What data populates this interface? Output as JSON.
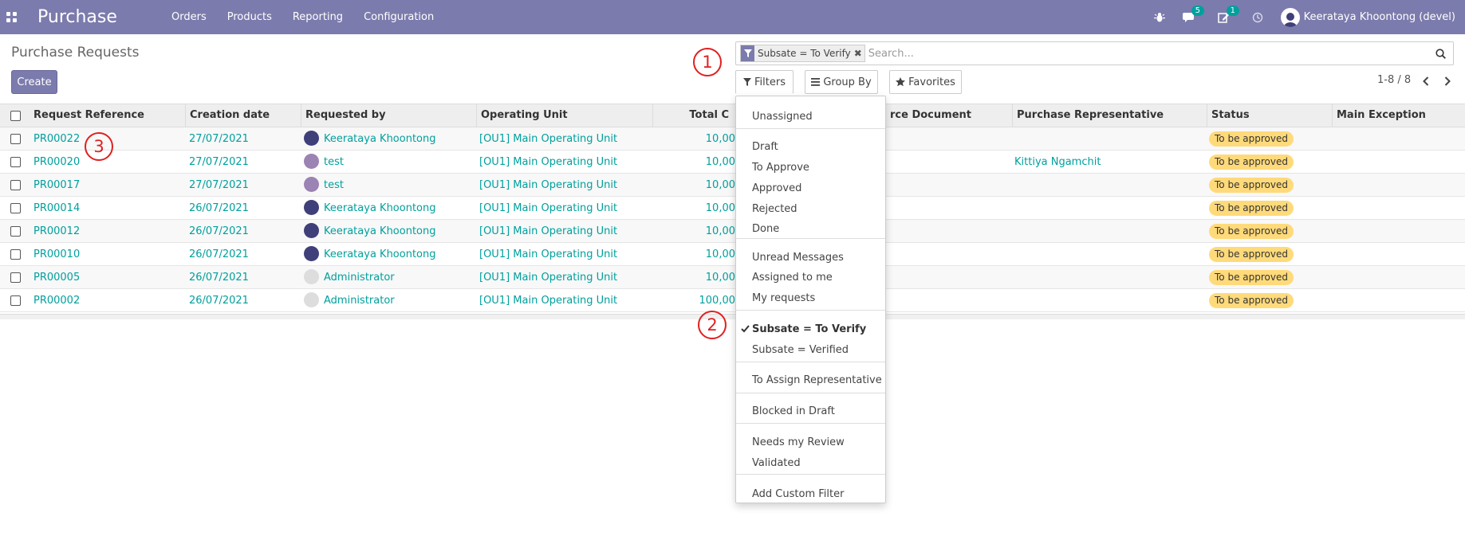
{
  "navbar": {
    "brand": "Purchase",
    "menu": [
      "Orders",
      "Products",
      "Reporting",
      "Configuration"
    ],
    "messages_count": "5",
    "activities_count": "1",
    "user_name": "Keerataya Khoontong (devel)"
  },
  "control_panel": {
    "title": "Purchase Requests",
    "create_label": "Create",
    "facet_value": "Subsate = To Verify",
    "search_placeholder": "Search...",
    "filters_label": "Filters",
    "groupby_label": "Group By",
    "favorites_label": "Favorites",
    "pager": "1-8 / 8"
  },
  "annotations": [
    "1",
    "2",
    "3"
  ],
  "table": {
    "headers": [
      "Request Reference",
      "Creation date",
      "Requested by",
      "Operating Unit",
      "Total C",
      "rce Document",
      "Purchase Representative",
      "Status",
      "Main Exception"
    ],
    "rows": [
      {
        "ref": "PR00022",
        "date": "27/07/2021",
        "by": "Keerataya Khoontong",
        "unit": "[OU1] Main Operating Unit",
        "total": "10,00",
        "rep": "",
        "status": "To be approved"
      },
      {
        "ref": "PR00020",
        "date": "27/07/2021",
        "by": "test",
        "unit": "[OU1] Main Operating Unit",
        "total": "10,00",
        "rep": "Kittiya Ngamchit",
        "status": "To be approved"
      },
      {
        "ref": "PR00017",
        "date": "27/07/2021",
        "by": "test",
        "unit": "[OU1] Main Operating Unit",
        "total": "10,00",
        "rep": "",
        "status": "To be approved"
      },
      {
        "ref": "PR00014",
        "date": "26/07/2021",
        "by": "Keerataya Khoontong",
        "unit": "[OU1] Main Operating Unit",
        "total": "10,00",
        "rep": "",
        "status": "To be approved"
      },
      {
        "ref": "PR00012",
        "date": "26/07/2021",
        "by": "Keerataya Khoontong",
        "unit": "[OU1] Main Operating Unit",
        "total": "10,00",
        "rep": "",
        "status": "To be approved"
      },
      {
        "ref": "PR00010",
        "date": "26/07/2021",
        "by": "Keerataya Khoontong",
        "unit": "[OU1] Main Operating Unit",
        "total": "10,00",
        "rep": "",
        "status": "To be approved"
      },
      {
        "ref": "PR00005",
        "date": "26/07/2021",
        "by": "Administrator",
        "unit": "[OU1] Main Operating Unit",
        "total": "10,00",
        "rep": "",
        "status": "To be approved"
      },
      {
        "ref": "PR00002",
        "date": "26/07/2021",
        "by": "Administrator",
        "unit": "[OU1] Main Operating Unit",
        "total": "100,00",
        "rep": "",
        "status": "To be approved"
      }
    ]
  },
  "filters_menu": {
    "items": [
      "Unassigned",
      "Draft",
      "To Approve",
      "Approved",
      "Rejected",
      "Done",
      "Unread Messages",
      "Assigned to me",
      "My requests",
      "Subsate = To Verify",
      "Subsate = Verified",
      "To Assign Representative",
      "Blocked in Draft",
      "Needs my Review",
      "Validated",
      "Add Custom Filter"
    ]
  },
  "colors": {
    "brand": "#7c7bad",
    "link": "#00a09d",
    "status_badge": "#ffda7a",
    "annotation": "#e02020"
  }
}
